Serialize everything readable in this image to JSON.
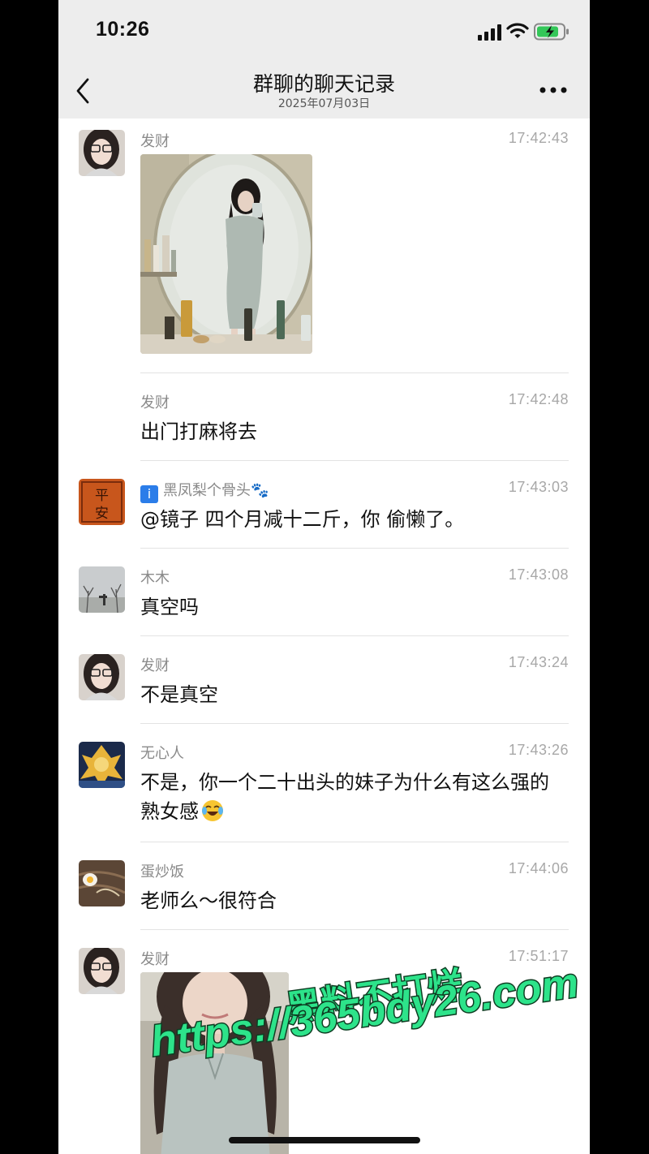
{
  "status": {
    "time": "10:26"
  },
  "nav": {
    "title": "群聊的聊天记录",
    "date": "2025年07月03日"
  },
  "messages": [
    {
      "sender": "发财",
      "time": "17:42:43",
      "kind": "image"
    },
    {
      "sender": "发财",
      "time": "17:42:48",
      "text": "出门打麻将去"
    },
    {
      "sender": "黑凤梨个骨头🐾",
      "time": "17:43:03",
      "text": "@镜子 四个月减十二斤，你 偷懒了。"
    },
    {
      "sender": "木木",
      "time": "17:43:08",
      "text": "真空吗"
    },
    {
      "sender": "发财",
      "time": "17:43:24",
      "text": "不是真空"
    },
    {
      "sender": "无心人",
      "time": "17:43:26",
      "text": "不是，你一个二十出头的妹子为什么有这么强的熟女感"
    },
    {
      "sender": "蛋炒饭",
      "time": "17:44:06",
      "text": "老师么～很符合"
    },
    {
      "sender": "发财",
      "time": "17:51:17",
      "kind": "image"
    }
  ],
  "avatar_text": {
    "pingan": "平安"
  },
  "watermark": {
    "line1": "黑料不打烊",
    "line2": "https://365bdy26.com"
  },
  "icons": [
    "signal-icon",
    "wifi-icon",
    "battery-icon",
    "back-arrow-icon",
    "more-icon",
    "laugh-cry-emoji-icon"
  ]
}
